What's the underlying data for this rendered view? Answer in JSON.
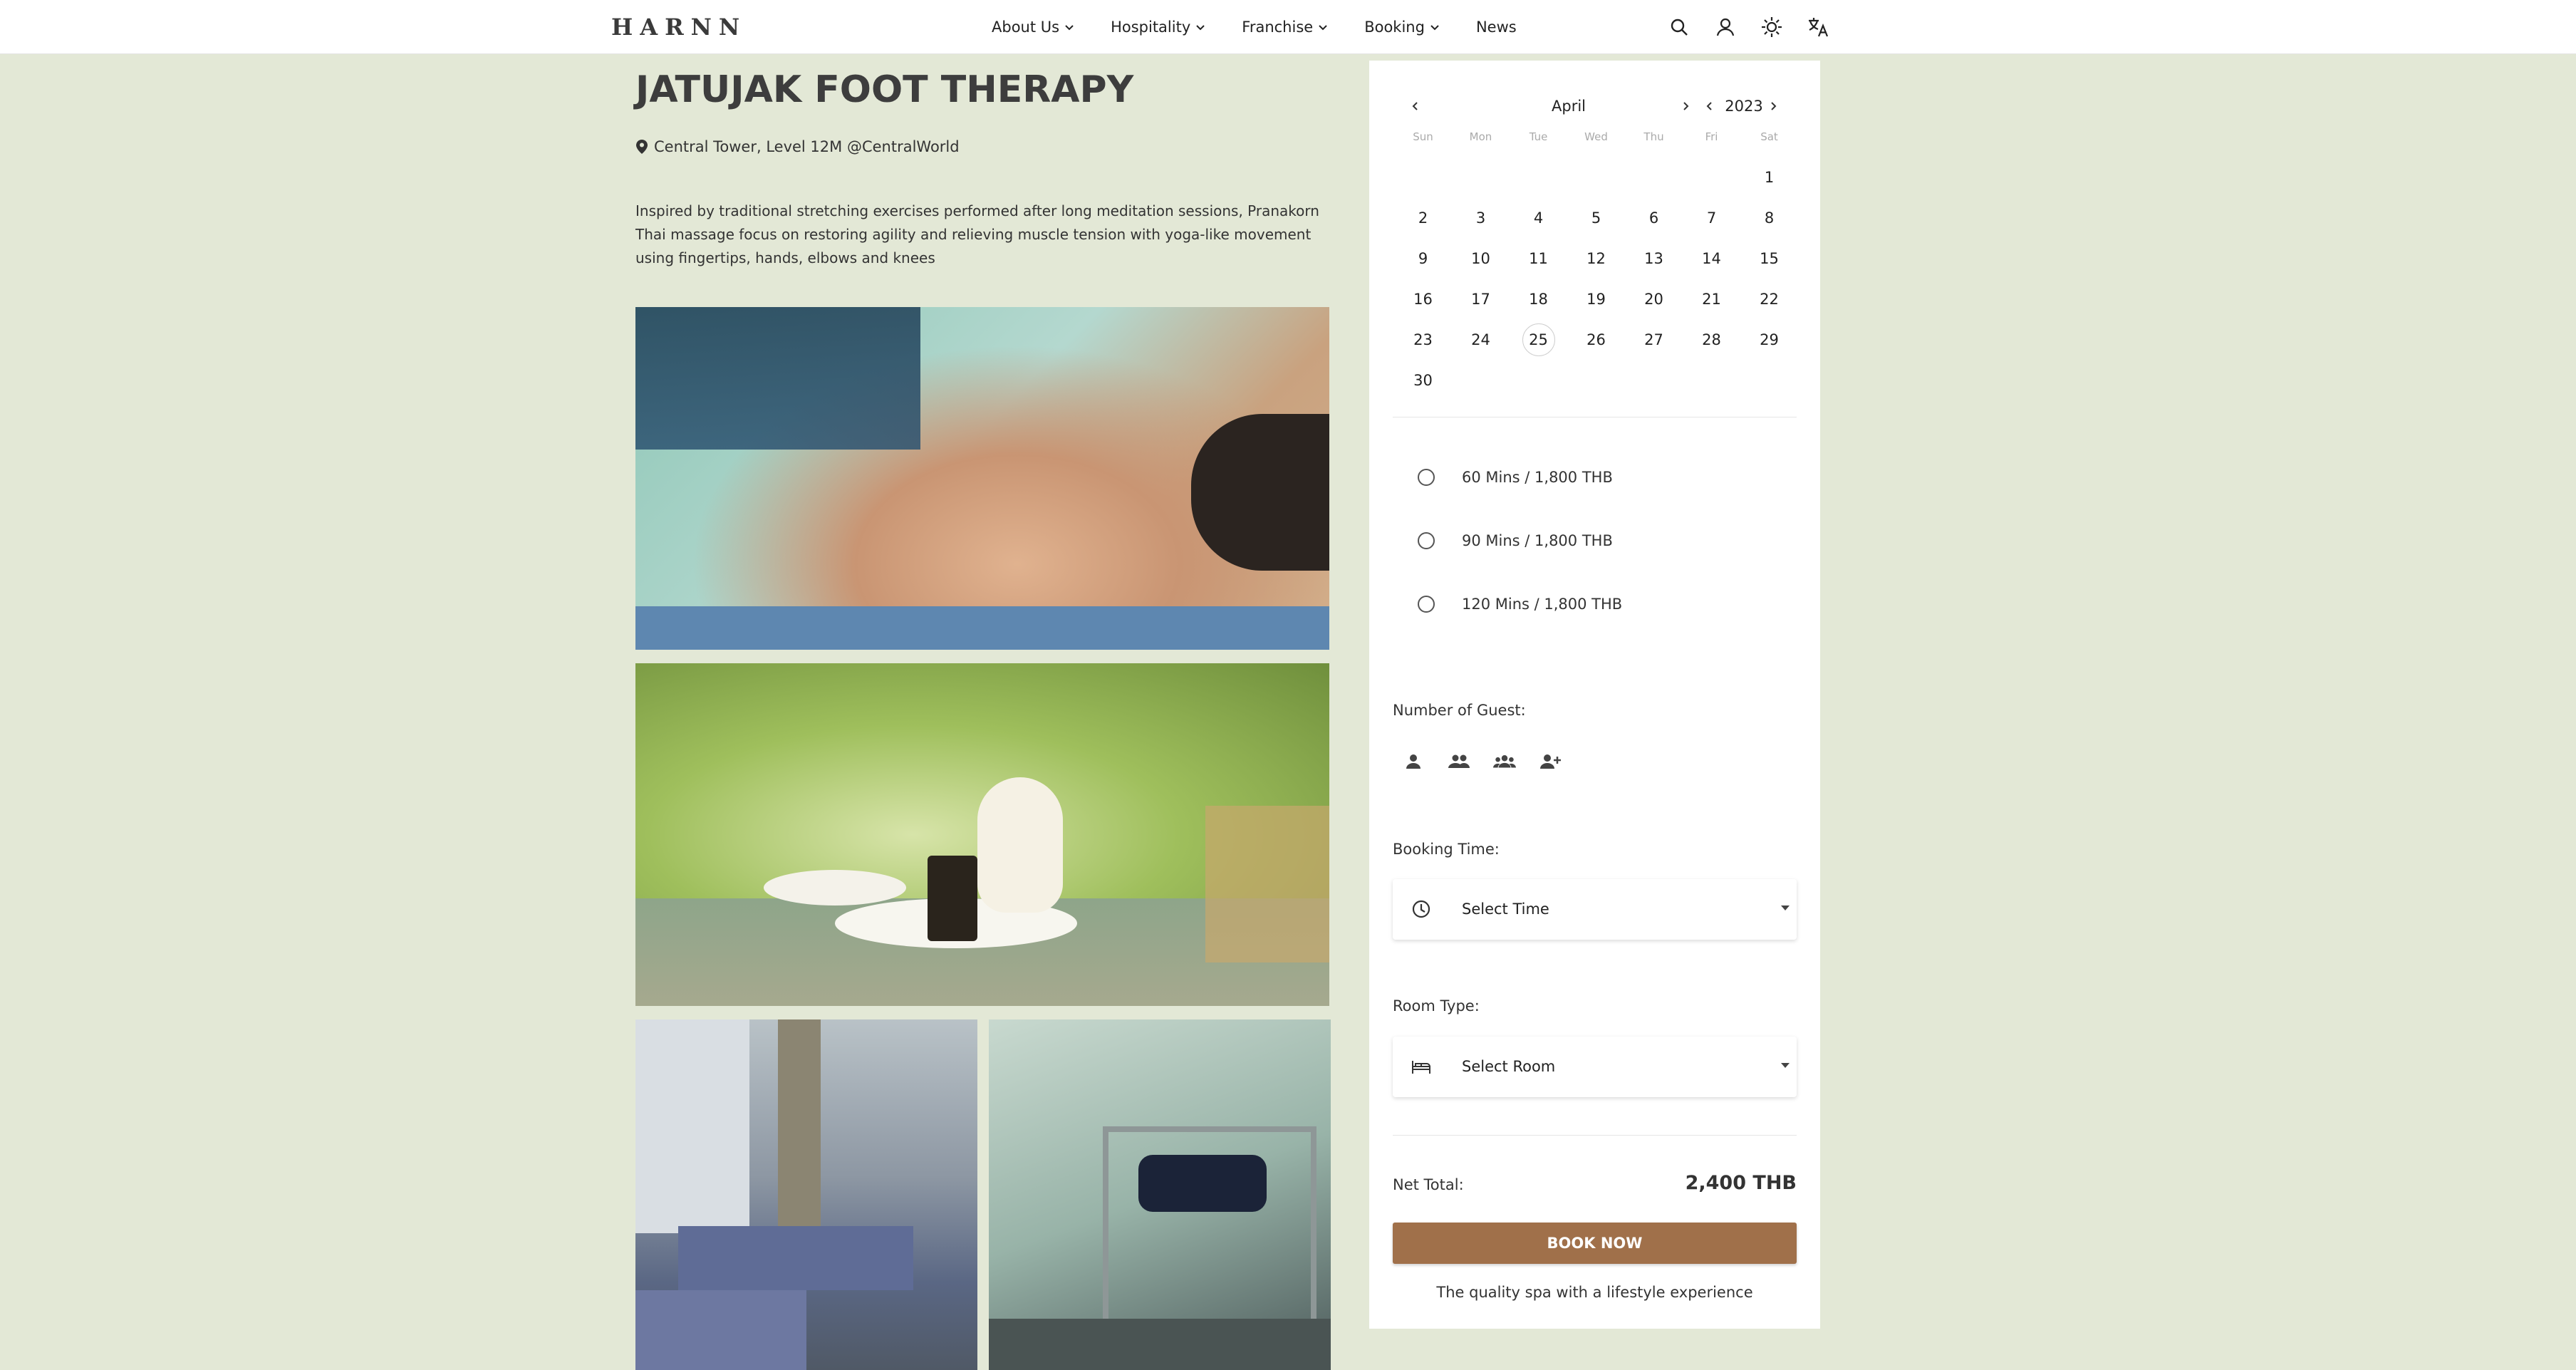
{
  "header": {
    "logo": "HARNN",
    "nav": [
      {
        "label": "About Us",
        "has_dropdown": true
      },
      {
        "label": "Hospitality",
        "has_dropdown": true
      },
      {
        "label": "Franchise",
        "has_dropdown": true
      },
      {
        "label": "Booking",
        "has_dropdown": true
      },
      {
        "label": "News",
        "has_dropdown": false
      }
    ],
    "icons": [
      "search-icon",
      "user-icon",
      "theme-sun-icon",
      "translate-icon"
    ]
  },
  "main": {
    "title": "JATUJAK FOOT THERAPY",
    "location": "Central Tower, Level 12M @CentralWorld",
    "description": "Inspired by traditional stretching exercises performed after long meditation sessions, Pranakorn Thai massage focus on restoring agility and relieving muscle tension with yoga-like movement using fingertips, hands, elbows and knees"
  },
  "calendar": {
    "month": "April",
    "year": "2023",
    "weekdays": [
      "Sun",
      "Mon",
      "Tue",
      "Wed",
      "Thu",
      "Fri",
      "Sat"
    ],
    "first_weekday_index": 6,
    "days_in_month": 30,
    "today": 25
  },
  "options": [
    {
      "label": "60 Mins / 1,800 THB"
    },
    {
      "label": "90 Mins / 1,800 THB"
    },
    {
      "label": "120 Mins / 1,800 THB"
    }
  ],
  "guests": {
    "label": "Number of Guest:",
    "icons": [
      "one-person-icon",
      "two-people-icon",
      "group-icon",
      "add-person-icon"
    ]
  },
  "booking_time": {
    "label": "Booking Time:",
    "value": "Select Time"
  },
  "room_type": {
    "label": "Room Type:",
    "value": "Select Room"
  },
  "total": {
    "label": "Net Total:",
    "value": "2,400 THB"
  },
  "book_button": "BOOK NOW",
  "tagline": "The quality spa with a lifestyle experience",
  "colors": {
    "page_bg": "#e3e8d6",
    "book_button": "#a0704a"
  }
}
